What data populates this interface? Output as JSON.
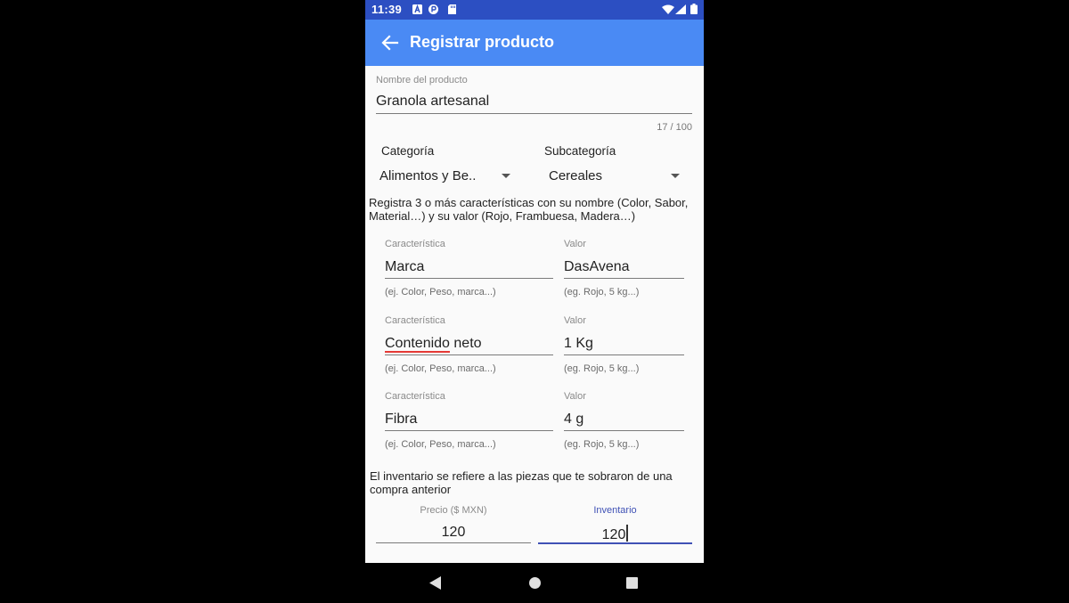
{
  "status_bar": {
    "time": "11:39"
  },
  "app_bar": {
    "title": "Registrar producto"
  },
  "product_name": {
    "label": "Nombre del producto",
    "value": "Granola artesanal",
    "counter": "17 / 100"
  },
  "category": {
    "label": "Categoría",
    "value": "Alimentos y Be.."
  },
  "subcategory": {
    "label": "Subcategoría",
    "value": "Cereales"
  },
  "characteristics_instructions": "Registra 3 o más características con su nombre (Color, Sabor, Material…) y su valor (Rojo, Frambuesa, Madera…)",
  "characteristics": [
    {
      "name_label": "Característica",
      "name_value_underlined": "Marca",
      "name_value_rest": "",
      "name_helper": "(ej. Color, Peso, marca...)",
      "value_label": "Valor",
      "value": "DasAvena",
      "value_helper": "(eg. Rojo, 5 kg...)"
    },
    {
      "name_label": "Característica",
      "name_value_underlined": "Contenido",
      "name_value_rest": " neto",
      "name_helper": "(ej. Color, Peso, marca...)",
      "value_label": "Valor",
      "value": "1 Kg",
      "value_helper": "(eg. Rojo, 5 kg...)"
    },
    {
      "name_label": "Característica",
      "name_value_underlined": "Fibra",
      "name_value_rest": "",
      "name_helper": "(ej. Color, Peso, marca...)",
      "value_label": "Valor",
      "value": "4 g",
      "value_helper": "(eg. Rojo, 5 kg...)"
    }
  ],
  "inventory_note": "El inventario se refiere a las piezas que te sobraron de una compra anterior",
  "price": {
    "label": "Precio ($ MXN)",
    "value": "120"
  },
  "inventory": {
    "label": "Inventario",
    "value": "120"
  },
  "colors": {
    "status_bar": "#2c4fc2",
    "app_bar": "#4a8af4",
    "focus": "#3f51b5",
    "spell_error": "#e53935"
  }
}
